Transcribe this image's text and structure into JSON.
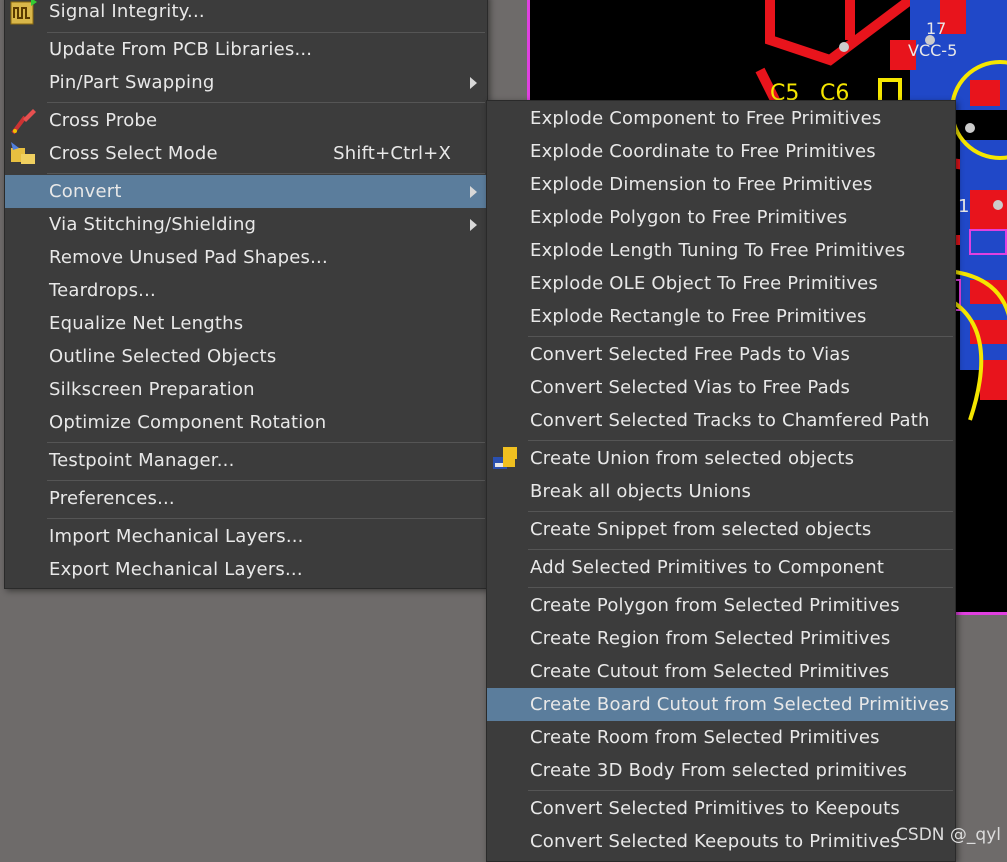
{
  "pcb": {
    "labels": [
      "C5",
      "C6",
      "17",
      "VCC-5",
      "1"
    ]
  },
  "main_menu": {
    "items": [
      {
        "label": "Signal Integrity...",
        "submenu": false
      },
      {
        "label": "Update From PCB Libraries...",
        "submenu": false
      },
      {
        "label": "Pin/Part Swapping",
        "submenu": true
      },
      {
        "label": "Cross Probe",
        "submenu": false
      },
      {
        "label": "Cross Select Mode",
        "shortcut": "Shift+Ctrl+X",
        "submenu": false
      },
      {
        "label": "Convert",
        "submenu": true,
        "highlighted": true
      },
      {
        "label": "Via Stitching/Shielding",
        "submenu": true
      },
      {
        "label": "Remove Unused Pad Shapes...",
        "submenu": false
      },
      {
        "label": "Teardrops...",
        "submenu": false
      },
      {
        "label": "Equalize Net Lengths",
        "submenu": false
      },
      {
        "label": "Outline Selected Objects",
        "submenu": false
      },
      {
        "label": "Silkscreen Preparation",
        "submenu": false
      },
      {
        "label": "Optimize Component Rotation",
        "submenu": false
      },
      {
        "label": "Testpoint Manager...",
        "submenu": false
      },
      {
        "label": "Preferences...",
        "submenu": false
      },
      {
        "label": "Import Mechanical Layers...",
        "submenu": false
      },
      {
        "label": "Export Mechanical Layers...",
        "submenu": false
      }
    ]
  },
  "convert_submenu": {
    "items": [
      {
        "label": "Explode Component to Free Primitives"
      },
      {
        "label": "Explode Coordinate to Free Primitives"
      },
      {
        "label": "Explode Dimension to Free Primitives"
      },
      {
        "label": "Explode Polygon to Free Primitives"
      },
      {
        "label": "Explode Length Tuning To Free Primitives"
      },
      {
        "label": "Explode OLE Object To Free Primitives"
      },
      {
        "label": "Explode Rectangle to Free Primitives"
      },
      {
        "label": "Convert Selected Free Pads to Vias"
      },
      {
        "label": "Convert Selected Vias to Free Pads"
      },
      {
        "label": "Convert Selected Tracks to Chamfered Path"
      },
      {
        "label": "Create Union from selected objects"
      },
      {
        "label": "Break all objects Unions"
      },
      {
        "label": "Create Snippet from selected objects"
      },
      {
        "label": "Add Selected Primitives to Component"
      },
      {
        "label": "Create Polygon from Selected Primitives"
      },
      {
        "label": "Create Region from Selected Primitives"
      },
      {
        "label": "Create Cutout from Selected Primitives"
      },
      {
        "label": "Create Board Cutout from Selected Primitives",
        "highlighted": true
      },
      {
        "label": "Create Room from Selected Primitives"
      },
      {
        "label": "Create 3D Body From selected primitives"
      },
      {
        "label": "Convert Selected Primitives to Keepouts"
      },
      {
        "label": "Convert Selected Keepouts to Primitives"
      }
    ]
  },
  "watermark": "CSDN @_qyl",
  "colors": {
    "menu_bg": "#3c3c3c",
    "highlight": "#5b7d9c",
    "pcb_bg": "#000000",
    "board_outline": "#e040e0",
    "track_red": "#e8141c",
    "silk_yellow": "#f5e600",
    "copper_blue": "#2048c8"
  }
}
